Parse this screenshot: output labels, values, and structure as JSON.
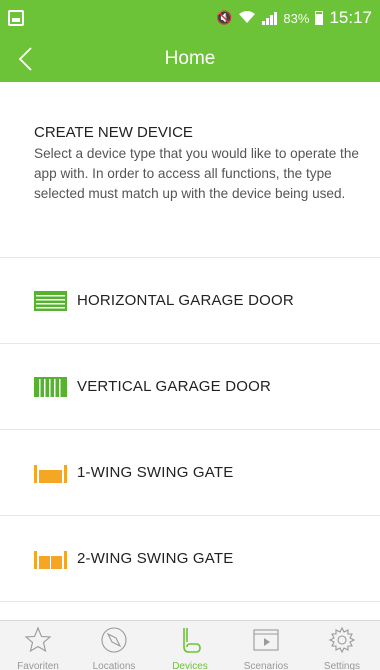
{
  "status_bar": {
    "battery_percent": "83%",
    "time": "15:17"
  },
  "header": {
    "title": "Home"
  },
  "intro": {
    "heading": "CREATE NEW DEVICE",
    "text": "Select a device type that you would like to operate the app with. In order to access all functions, the type selected must match up with the device being used."
  },
  "devices": [
    {
      "label": "HORIZONTAL GARAGE DOOR",
      "icon": "horizontal-garage-door-icon",
      "color": "#55b32f"
    },
    {
      "label": "VERTICAL GARAGE DOOR",
      "icon": "vertical-garage-door-icon",
      "color": "#55b32f"
    },
    {
      "label": "1-WING SWING GATE",
      "icon": "one-wing-swing-gate-icon",
      "color": "#f5a623"
    },
    {
      "label": "2-WING SWING GATE",
      "icon": "two-wing-swing-gate-icon",
      "color": "#f5a623"
    }
  ],
  "tabs": [
    {
      "label": "Favoriten",
      "icon": "star-icon",
      "active": false
    },
    {
      "label": "Locations",
      "icon": "compass-icon",
      "active": false
    },
    {
      "label": "Devices",
      "icon": "devices-icon",
      "active": true
    },
    {
      "label": "Scenarios",
      "icon": "play-icon",
      "active": false
    },
    {
      "label": "Settings",
      "icon": "gear-icon",
      "active": false
    }
  ],
  "colors": {
    "brand_green": "#6cc337",
    "gate_orange": "#f5a623",
    "inactive_gray": "#999999"
  }
}
